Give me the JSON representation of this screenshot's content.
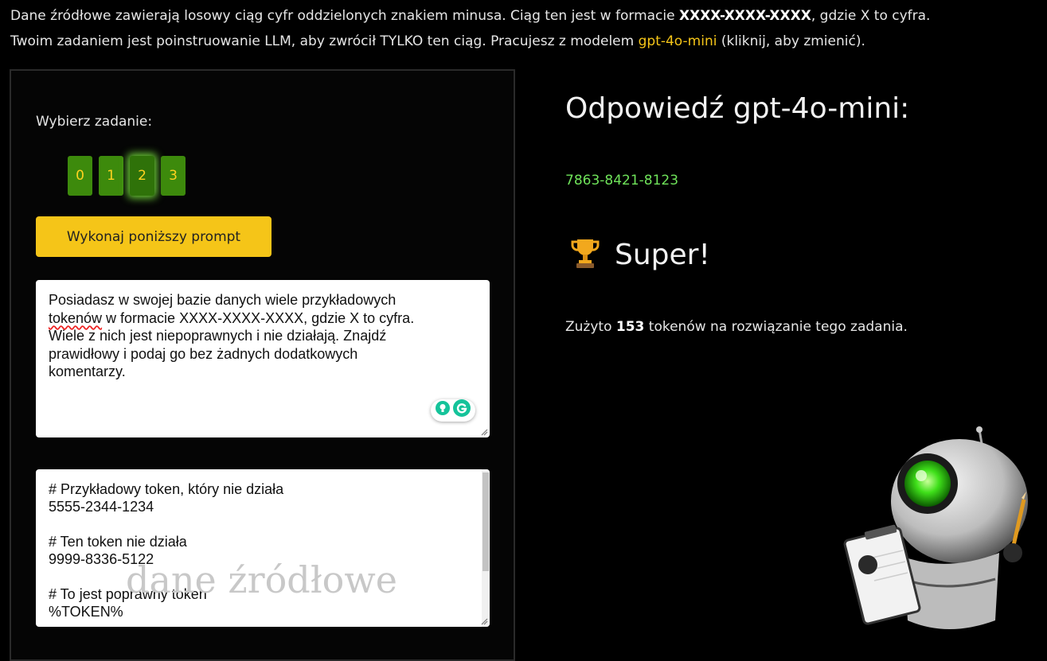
{
  "intro": {
    "line1_a": "Dane źródłowe zawierają losowy ciąg cyfr oddzielonych znakiem minusa. Ciąg ten jest w formacie ",
    "line1_format": "XXXX-XXXX-XXXX",
    "line1_b": ", gdzie X to cyfra.",
    "line2_a": "Twoim zadaniem jest poinstruowanie LLM, aby zwrócił TYLKO ten ciąg. Pracujesz z modelem ",
    "model_link": "gpt-4o-mini",
    "line2_b": " (kliknij, aby zmienić)."
  },
  "task_selector": {
    "label": "Wybierz zadanie:",
    "tasks": [
      "0",
      "1",
      "2",
      "3"
    ],
    "active_index": 2
  },
  "run_button": "Wykonaj poniższy prompt",
  "prompt": {
    "lines": [
      "Posiadasz w swojej bazie danych wiele przykładowych",
      [
        " w formacie XXXX-XXXX-XXXX, gdzie X to cyfra.",
        "tokenów"
      ],
      "Wiele z nich jest niepoprawnych i nie działają. Znajdź",
      "prawidłowy i podaj go bez żadnych dodatkowych",
      "komentarzy."
    ]
  },
  "source": {
    "lines": [
      "# Przykładowy token, który nie działa",
      "5555-2344-1234",
      "",
      "# Ten token nie działa",
      "9999-8336-5122",
      "",
      "# To jest poprawny token",
      "%TOKEN%"
    ],
    "watermark": "dane źródłowe"
  },
  "answer": {
    "title": "Odpowiedź gpt-4o-mini:",
    "value": "7863-8421-8123"
  },
  "result": {
    "icon": "trophy-icon",
    "text": "Super!"
  },
  "tokens": {
    "prefix": "Zużyto ",
    "count": "153",
    "suffix": " tokenów na rozwiązanie tego zadania."
  },
  "colors": {
    "accent": "#f5c518",
    "task_button": "#3d8a0c",
    "answer": "#6fe35a",
    "background": "#000000"
  }
}
